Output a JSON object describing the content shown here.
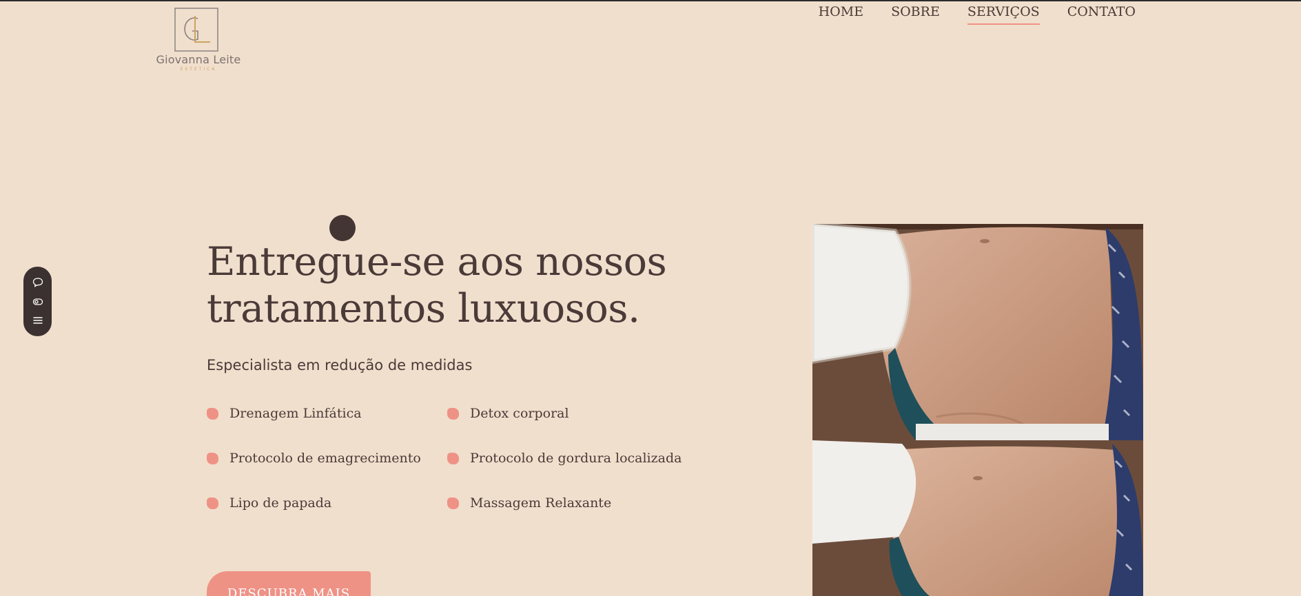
{
  "brand": {
    "name": "Giovanna Leite",
    "tagline": "ESTÉTICA",
    "accent_color": "#ef9286",
    "text_color": "#4a3a38",
    "background_color": "#f1dfcd",
    "logo_gold": "#c9a463"
  },
  "nav": {
    "items": [
      {
        "label": "HOME",
        "active": false
      },
      {
        "label": "SOBRE",
        "active": false
      },
      {
        "label": "SERVIÇOS",
        "active": true
      },
      {
        "label": "CONTATO",
        "active": false
      }
    ]
  },
  "widget": {
    "icons": [
      "chat-bubble-icon",
      "toggle-icon",
      "menu-icon"
    ]
  },
  "hero": {
    "title_line1": "Entregue-se aos nossos",
    "title_line2": "tratamentos luxuosos.",
    "subtitle": "Especialista em redução de medidas",
    "services": [
      "Drenagem Linfática",
      "Detox corporal",
      "Protocolo de emagrecimento",
      "Protocolo de gordura localizada",
      "Lipo de papada",
      "Massagem Relaxante"
    ],
    "cta_label": "DESCUBRA MAIS"
  },
  "photos": {
    "before_icon": "abdomen-before-photo",
    "after_icon": "abdomen-after-photo"
  }
}
